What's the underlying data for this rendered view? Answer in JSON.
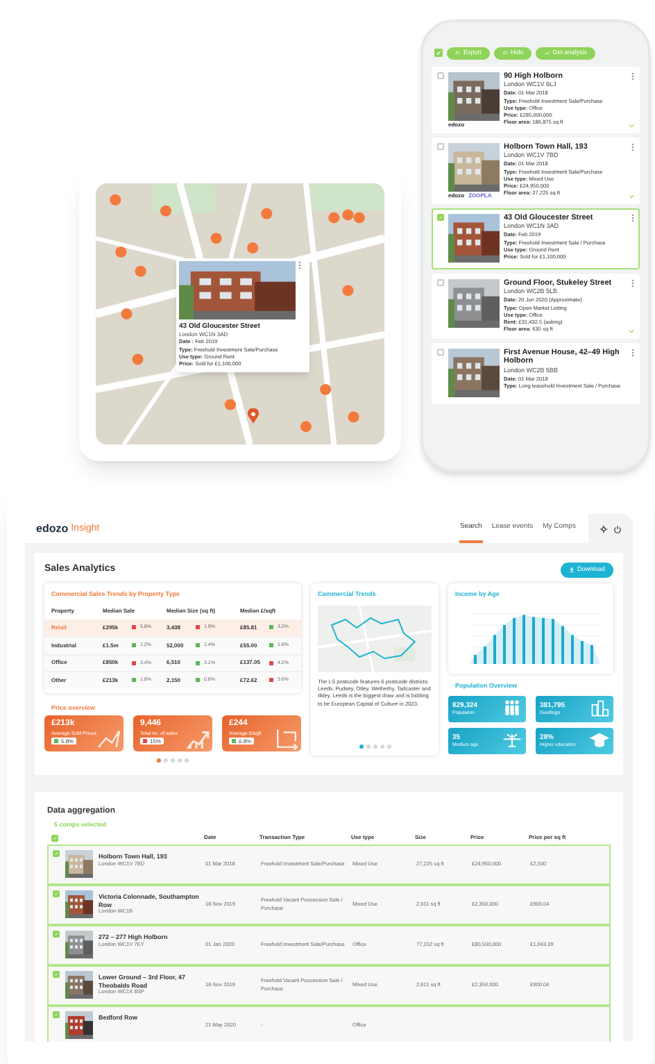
{
  "phone": {
    "select_all": {
      "checked": true
    },
    "actions": [
      {
        "label": "Export",
        "kind": "export"
      },
      {
        "label": "Hide",
        "kind": "hide"
      },
      {
        "label": "Get analysis",
        "kind": "analysis"
      }
    ],
    "listings": [
      {
        "title": "90 High Holborn",
        "address": "London WC1V 6LJ",
        "details": [
          "**Date:** 01 Mar 2018",
          "**Type:** Freehold Investment Sale/Purchase",
          "**Use type:** Office",
          "**Price:** £285,000,000",
          "**Floor area:** 186,875 sq ft"
        ],
        "sources": [
          "edozo"
        ],
        "selected": false,
        "expandable": true
      },
      {
        "title": "Holborn Town Hall, 193",
        "address": "London WC1V 7BD",
        "details": [
          "**Date:** 01 Mar 2018",
          "**Type:** Freehold Investment Sale/Purchase",
          "**Use type:** Mixed Use",
          "**Price:** £24,950,000",
          "**Floor area:** 27,225 sq ft"
        ],
        "sources": [
          "edozo",
          "ZOOPLA"
        ],
        "selected": false,
        "expandable": true
      },
      {
        "title": "43 Old Gloucester Street",
        "address": "London WC1N 3AD",
        "details": [
          "**Date:** Feb 2019",
          "**Type:** Freehold Investment Sale / Purchase",
          "**Use type:** Ground Rent",
          "**Price:** Sold for £1,100,000"
        ],
        "selected": true,
        "expandable": false
      },
      {
        "title": "Ground Floor, Stukeley Street",
        "address": "London WC2B 5LB",
        "details": [
          "**Date:** 20 Jun 2020 (Approximate)",
          "**Type:** Open Market Letting",
          "**Use type:** Office",
          "**Rent:** £31,432.5 (asking)",
          "**Floor area:** 635 sq ft"
        ],
        "selected": false,
        "expandable": true
      },
      {
        "title": "First Avenue House, 42–49 High Holborn",
        "address": "London WC2B 5BB",
        "details": [
          "**Date:** 01 Mar 2018",
          "**Type:** Long leasehold Investment Sale / Purchase"
        ],
        "selected": false,
        "expandable": false
      }
    ]
  },
  "map_card": {
    "popup": {
      "title": "43 Old Gloucester Street",
      "address": "London WC1N 3AD",
      "details": [
        "**Date :** Feb 2019",
        "**Type:** Freehold Investment Sale/Purchase",
        "**Use type:** Ground Rent",
        "**Price:** Sold for £1,100,000"
      ]
    }
  },
  "desktop": {
    "logo": "edozo",
    "product": "Insight",
    "nav": [
      {
        "label": "Search",
        "selected": true
      },
      {
        "label": "Lease events",
        "selected": false
      },
      {
        "label": "My Comps",
        "selected": false
      }
    ],
    "sales_analytics": {
      "title": "Sales Analytics",
      "download": "Download",
      "trends_table": {
        "title": "Commercial Sales Trends by Property Type",
        "columns": [
          "Property",
          "Median Sale",
          "Median Size (sq ft)",
          "Median £/sqft"
        ],
        "rows": [
          {
            "selected": true,
            "cells": [
              {
                "value": "Retail"
              },
              {
                "value": "£295k",
                "change": "5.8%",
                "rising": false
              },
              {
                "value": "3,438",
                "change": "1.9%",
                "rising": false
              },
              {
                "value": "£85.81",
                "change": "3.2%",
                "rising": true
              }
            ]
          },
          {
            "selected": false,
            "cells": [
              {
                "value": "Industrial"
              },
              {
                "value": "£1.5m",
                "change": "1.2%",
                "rising": true
              },
              {
                "value": "52,000",
                "change": "1.4%",
                "rising": true
              },
              {
                "value": "£55.00",
                "change": "1.8%",
                "rising": true
              }
            ]
          },
          {
            "selected": false,
            "cells": [
              {
                "value": "Office"
              },
              {
                "value": "£850k",
                "change": "3.4%",
                "rising": false
              },
              {
                "value": "6,510",
                "change": "3.1%",
                "rising": true
              },
              {
                "value": "£137.05",
                "change": "4.2%",
                "rising": false
              }
            ]
          },
          {
            "selected": false,
            "cells": [
              {
                "value": "Other"
              },
              {
                "value": "£213k",
                "change": "1.8%",
                "rising": true
              },
              {
                "value": "2,150",
                "change": "0.8%",
                "rising": true
              },
              {
                "value": "£72.62",
                "change": "3.6%",
                "rising": false
              }
            ]
          }
        ]
      },
      "price_overview": {
        "title": "Price overview",
        "cards": [
          {
            "value": "£213k",
            "label": "Average Sold Prices",
            "change": "5.8%",
            "rising": true,
            "kind": "line"
          },
          {
            "value": "9,446",
            "label": "Total no. of sales",
            "change": "15%",
            "rising": false,
            "kind": "growth"
          },
          {
            "value": "£244",
            "label": "Average £/sqft",
            "change": "6.8%",
            "rising": true,
            "kind": "area"
          }
        ],
        "pages": [
          {
            "selected": true
          },
          {
            "selected": false
          },
          {
            "selected": false
          },
          {
            "selected": false
          },
          {
            "selected": false
          }
        ]
      },
      "commercial_trends": {
        "title": "Commercial Trends",
        "text": "The LS postcode features 6 postcode districts: Leeds, Pudsey, Otley, Wetherby, Tadcaster and Ilkley. Leeds is the biggest draw and is bidding to be European Capital of Culture in 2023.",
        "pages": [
          {
            "selected": true
          },
          {
            "selected": false
          },
          {
            "selected": false
          },
          {
            "selected": false
          },
          {
            "selected": false
          }
        ]
      },
      "income_by_age": {
        "title": "Income by Age"
      },
      "population_overview": {
        "title": "Population Overview",
        "tiles": [
          {
            "value": "829,324",
            "label": "Population",
            "kind": "people"
          },
          {
            "value": "381,795",
            "label": "Dwellings",
            "kind": "buildings"
          },
          {
            "value": "35",
            "label": "Medium age",
            "kind": "scale"
          },
          {
            "value": "28%",
            "label": "Higher education",
            "kind": "education"
          }
        ]
      }
    },
    "data_aggregation": {
      "title": "Data aggregation",
      "selected_count": "5 comps selected",
      "select_all": {
        "checked": true
      },
      "columns": [
        "Date",
        "Transaction Type",
        "Use type",
        "Size",
        "Price",
        "Price per sq ft"
      ],
      "rows": [
        {
          "checked": true,
          "title": "Holborn Town Hall, 193",
          "address": "London WC1V 7BD",
          "cells": [
            "01 Mar 2018",
            "Freehold Investment Sale/Purchase",
            "Mixed Use",
            "27,225 sq ft",
            "£24,950,000",
            "£2,500"
          ]
        },
        {
          "checked": true,
          "title": "Victoria Colonnade, Southampton Row",
          "address": "London WC1B",
          "cells": [
            "16 Nov 2019",
            "Freehold Vacant Possession Sale / Purchase",
            "Mixed Use",
            "2,611 sq ft",
            "£2,350,000",
            "£900.04"
          ]
        },
        {
          "checked": true,
          "title": "272 – 277 High Holborn",
          "address": "London WC1V 7EY",
          "cells": [
            "01 Jan 2020",
            "Freehold Investment Sale/Purchase",
            "Office",
            "77,152 sq ft",
            "£80,500,000",
            "£1,043.39"
          ]
        },
        {
          "checked": true,
          "title": "Lower Ground – 3rd Floor, 47 Theobalds Road",
          "address": "London WC1X 8SP",
          "cells": [
            "16 Nov 2019",
            "Freehold Vacant Possession Sale / Purchase",
            "Mixed Use",
            "2,611 sq ft",
            "£2,350,000",
            "£900.04"
          ]
        },
        {
          "checked": true,
          "title": "Bedford Row",
          "cells": [
            "21 May 2020",
            "-",
            "Office"
          ]
        }
      ]
    }
  }
}
